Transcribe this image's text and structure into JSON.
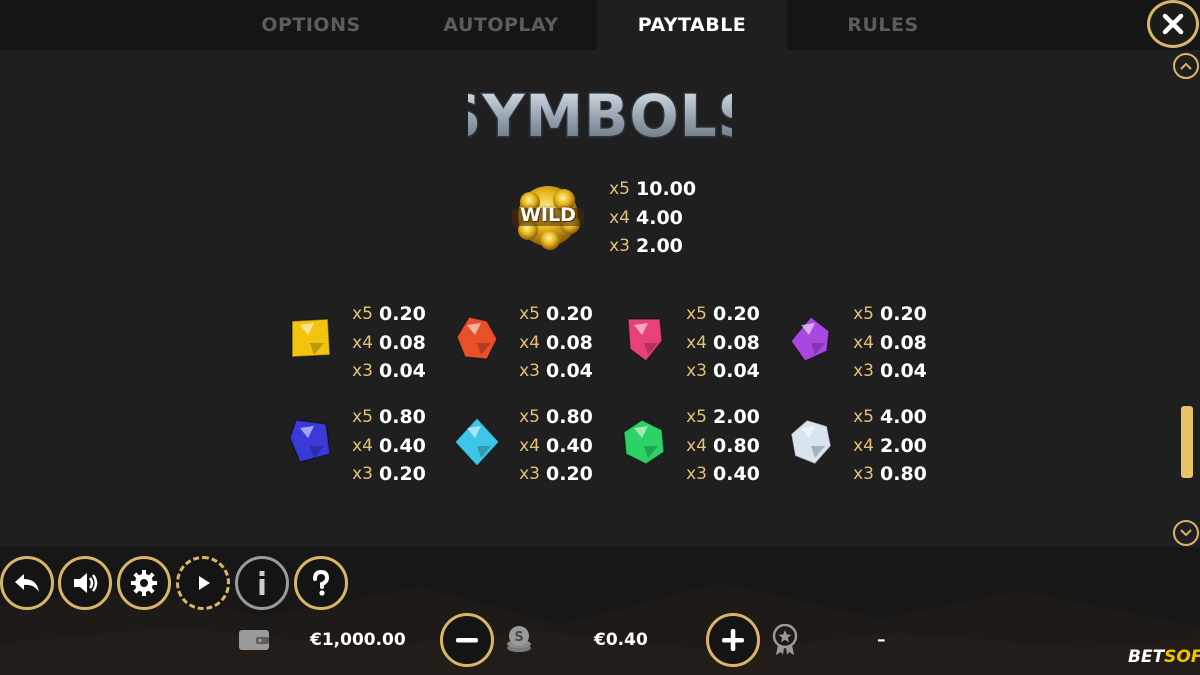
{
  "tabs": [
    {
      "label": "OPTIONS",
      "active": false
    },
    {
      "label": "AUTOPLAY",
      "active": false
    },
    {
      "label": "PAYTABLE",
      "active": true
    },
    {
      "label": "RULES",
      "active": false
    }
  ],
  "section_title": "SYMBOLS",
  "wild": {
    "label": "WILD",
    "payouts": [
      {
        "mult": "x5",
        "value": "10.00"
      },
      {
        "mult": "x4",
        "value": "4.00"
      },
      {
        "mult": "x3",
        "value": "2.00"
      }
    ]
  },
  "gems": [
    {
      "name": "yellow-gem",
      "color": "#f2c40f",
      "payouts": [
        {
          "mult": "x5",
          "value": "0.20"
        },
        {
          "mult": "x4",
          "value": "0.08"
        },
        {
          "mult": "x3",
          "value": "0.04"
        }
      ]
    },
    {
      "name": "red-gem",
      "color": "#e8502a",
      "payouts": [
        {
          "mult": "x5",
          "value": "0.20"
        },
        {
          "mult": "x4",
          "value": "0.08"
        },
        {
          "mult": "x3",
          "value": "0.04"
        }
      ]
    },
    {
      "name": "pink-gem",
      "color": "#e8407a",
      "payouts": [
        {
          "mult": "x5",
          "value": "0.20"
        },
        {
          "mult": "x4",
          "value": "0.08"
        },
        {
          "mult": "x3",
          "value": "0.04"
        }
      ]
    },
    {
      "name": "purple-gem",
      "color": "#a948e0",
      "payouts": [
        {
          "mult": "x5",
          "value": "0.20"
        },
        {
          "mult": "x4",
          "value": "0.08"
        },
        {
          "mult": "x3",
          "value": "0.04"
        }
      ]
    },
    {
      "name": "blue-gem",
      "color": "#3a3ad8",
      "payouts": [
        {
          "mult": "x5",
          "value": "0.80"
        },
        {
          "mult": "x4",
          "value": "0.40"
        },
        {
          "mult": "x3",
          "value": "0.20"
        }
      ]
    },
    {
      "name": "cyan-gem",
      "color": "#3ec6e8",
      "payouts": [
        {
          "mult": "x5",
          "value": "0.80"
        },
        {
          "mult": "x4",
          "value": "0.40"
        },
        {
          "mult": "x3",
          "value": "0.20"
        }
      ]
    },
    {
      "name": "green-gem",
      "color": "#2ed166",
      "payouts": [
        {
          "mult": "x5",
          "value": "2.00"
        },
        {
          "mult": "x4",
          "value": "0.80"
        },
        {
          "mult": "x3",
          "value": "0.40"
        }
      ]
    },
    {
      "name": "white-gem",
      "color": "#d9e4ef",
      "payouts": [
        {
          "mult": "x5",
          "value": "4.00"
        },
        {
          "mult": "x4",
          "value": "2.00"
        },
        {
          "mult": "x3",
          "value": "0.80"
        }
      ]
    }
  ],
  "footer": {
    "balance": "€1,000.00",
    "bet": "€0.40",
    "win": "–",
    "logo_bet": "BET",
    "logo_soft": "SOFT"
  },
  "colors": {
    "accent_gold": "#d9b56a",
    "tab_inactive": "#5c5c5c",
    "mult_gold": "#e2c27a"
  },
  "icons": [
    "close-icon",
    "scroll-up-icon",
    "scroll-down-icon",
    "back-icon",
    "sound-icon",
    "settings-icon",
    "autoplay-icon",
    "info-icon",
    "help-icon",
    "wallet-icon",
    "minus-icon",
    "coins-icon",
    "plus-icon",
    "award-icon"
  ]
}
